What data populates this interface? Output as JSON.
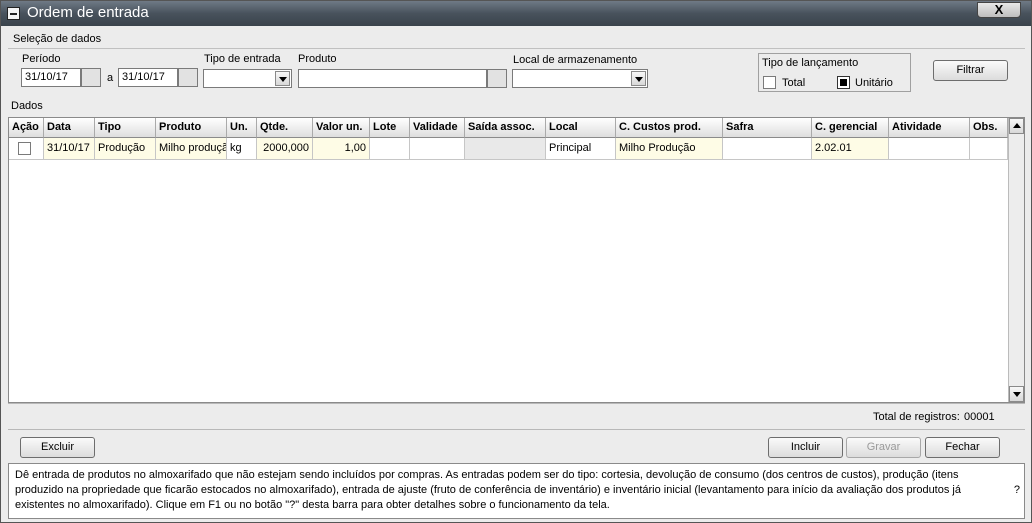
{
  "window": {
    "title": "Ordem de entrada",
    "close_label": "X"
  },
  "selection": {
    "section_label": "Seleção de dados",
    "period_label": "Período",
    "period_from": "31/10/17",
    "period_sep": "a",
    "period_to": "31/10/17",
    "entry_type_label": "Tipo de entrada",
    "entry_type_value": "",
    "product_label": "Produto",
    "product_value": "",
    "storage_label": "Local de armazenamento",
    "storage_value": "",
    "launch_type_label": "Tipo de lançamento",
    "launch_total_label": "Total",
    "launch_unit_label": "Unitário",
    "launch_selected": "Unitário",
    "filter_button": "Filtrar"
  },
  "data_section_label": "Dados",
  "table": {
    "columns": [
      "Ação",
      "Data",
      "Tipo",
      "Produto",
      "Un.",
      "Qtde.",
      "Valor un.",
      "Lote",
      "Validade",
      "Saída assoc.",
      "Local",
      "C. Custos prod.",
      "Safra",
      "C. gerencial",
      "Atividade",
      "Obs."
    ],
    "rows": [
      [
        "",
        "31/10/17",
        "Produção",
        "Milho produção",
        "kg",
        "2000,000",
        "1,00",
        "",
        "",
        "",
        "Principal",
        "Milho Produção",
        "",
        "2.02.01",
        "",
        ""
      ]
    ]
  },
  "totals": {
    "label": "Total de registros:",
    "value": "00001"
  },
  "actions": {
    "delete": "Excluir",
    "include": "Incluir",
    "save": "Gravar",
    "close": "Fechar"
  },
  "help": {
    "text": "Dê entrada de produtos no almoxarifado que não estejam sendo incluídos por compras. As entradas podem ser do tipo: cortesia, devolução de consumo (dos centros de custos), produção (itens produzido na propriedade que ficarão estocados no almoxarifado), entrada de ajuste (fruto de conferência de inventário) e inventário inicial (levantamento para início da avaliação dos produtos já existentes no almoxarifado). Clique em F1 ou no botão \"?\" desta barra para obter detalhes sobre o funcionamento da tela.",
    "question_mark": "?"
  }
}
